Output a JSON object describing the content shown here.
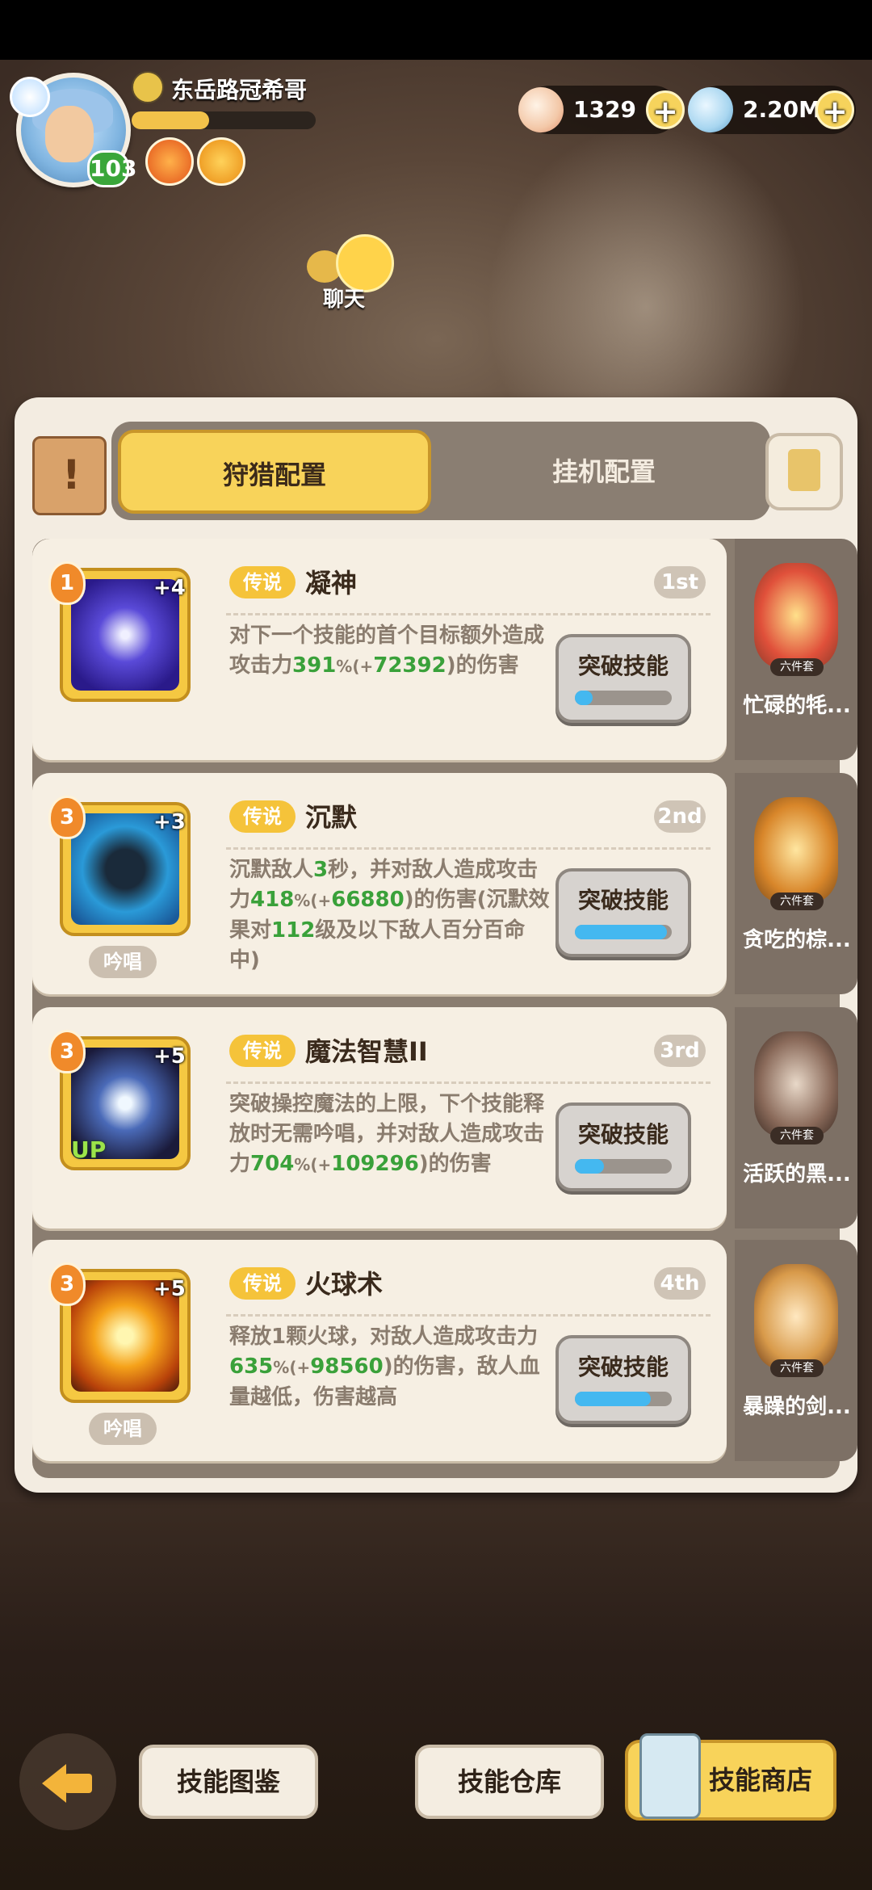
{
  "player": {
    "name": "东岳路冠希哥",
    "level": "103",
    "xp_fraction": 0.42
  },
  "resources": [
    {
      "icon": "shell-icon",
      "value": "1329"
    },
    {
      "icon": "clam-icon",
      "value": "2.20M"
    }
  ],
  "chat": {
    "label": "聊天"
  },
  "tabs": {
    "hunt": "狩猎配置",
    "idle": "挂机配置"
  },
  "skills": [
    {
      "level": "1",
      "plus": "+4",
      "tag": "传说",
      "name": "凝神",
      "rank": "1st",
      "desc": [
        "对下一个技能的首个目标额外造成攻击力",
        "391",
        "%(+",
        "72392",
        ")的伤害"
      ],
      "breakthrough": "突破技能",
      "progress": 0.18,
      "chant": "",
      "companion": {
        "set": "六件套",
        "name": "忙碌的牦..."
      }
    },
    {
      "level": "3",
      "plus": "+3",
      "tag": "传说",
      "name": "沉默",
      "rank": "2nd",
      "desc": [
        "沉默敌人",
        "3",
        "秒，并对敌人造成攻击力",
        "418",
        "%(+",
        "66880",
        ")的伤害(沉默效果对",
        "112",
        "级及以下敌人百分百命中)"
      ],
      "breakthrough": "突破技能",
      "progress": 0.95,
      "chant": "吟唱",
      "companion": {
        "set": "六件套",
        "name": "贪吃的棕..."
      }
    },
    {
      "level": "3",
      "plus": "+5",
      "tag": "传说",
      "name": "魔法智慧II",
      "rank": "3rd",
      "up": "UP",
      "desc": [
        "突破操控魔法的上限，下个技能释放时无需吟唱，并对敌人造成攻击力",
        "704",
        "%(+",
        "109296",
        ")的伤害"
      ],
      "breakthrough": "突破技能",
      "progress": 0.3,
      "chant": "",
      "companion": {
        "set": "六件套",
        "name": "活跃的黑..."
      }
    },
    {
      "level": "3",
      "plus": "+5",
      "tag": "传说",
      "name": "火球术",
      "rank": "4th",
      "desc": [
        "释放1颗火球，对敌人造成攻击力",
        "635",
        "%(+",
        "98560",
        ")的伤害，敌人血量越低，伤害越高"
      ],
      "breakthrough": "突破技能",
      "progress": 0.78,
      "chant": "吟唱",
      "companion": {
        "set": "六件套",
        "name": "暴躁的剑..."
      }
    }
  ],
  "bottom": {
    "codex": "技能图鉴",
    "storage": "技能仓库",
    "shop": "技能商店"
  },
  "colors": {
    "accent": "#f8d35a",
    "bonus_green": "#3aa13a",
    "progress_blue": "#44b8f0"
  }
}
